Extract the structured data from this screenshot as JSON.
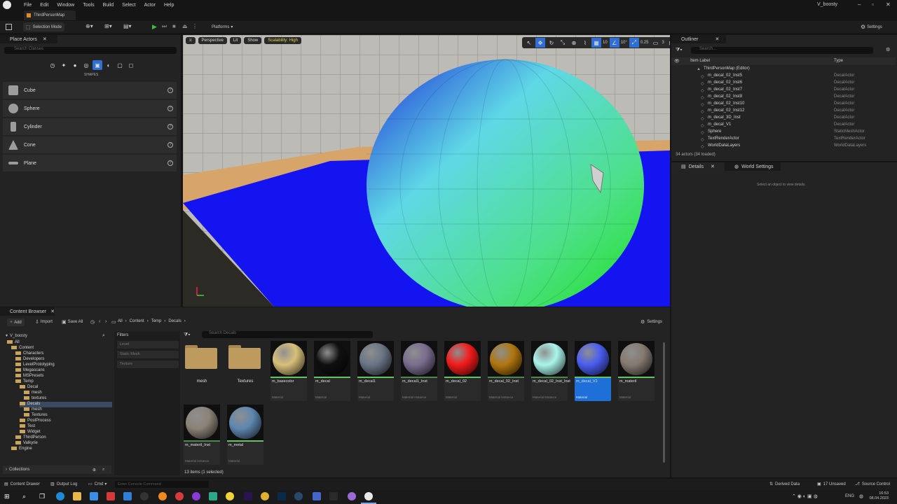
{
  "menu": [
    "File",
    "Edit",
    "Window",
    "Tools",
    "Build",
    "Select",
    "Actor",
    "Help"
  ],
  "project_name": "V_boosty",
  "level_tab": "ThirdPersonMap",
  "toolbar": {
    "selection_mode": "Selection Mode",
    "platforms": "Platforms",
    "settings": "Settings"
  },
  "place_actors": {
    "tab": "Place Actors",
    "search_placeholder": "Search Classes",
    "category": "SHAPES",
    "items": [
      "Cube",
      "Sphere",
      "Cylinder",
      "Cone",
      "Plane"
    ]
  },
  "viewport": {
    "perspective": "Perspective",
    "lit": "Lit",
    "show": "Show",
    "scalability": "Scalability: High",
    "grid": "10",
    "angle": "10°",
    "scale": "0.25",
    "camera": "3"
  },
  "outliner": {
    "tab": "Outliner",
    "search_placeholder": "Search...",
    "col_label": "Item Label",
    "col_type": "Type",
    "rows": [
      {
        "name": "ThirdPersonMap (Editor)",
        "type": ""
      },
      {
        "name": "m_decal_02_Inst5",
        "type": "DecalActor"
      },
      {
        "name": "m_decal_02_Inst6",
        "type": "DecalActor"
      },
      {
        "name": "m_decal_02_Inst7",
        "type": "DecalActor"
      },
      {
        "name": "m_decal_02_Inst8",
        "type": "DecalActor"
      },
      {
        "name": "m_decal_02_Inst10",
        "type": "DecalActor"
      },
      {
        "name": "m_decal_02_Inst12",
        "type": "DecalActor"
      },
      {
        "name": "m_decal_3D_Inst",
        "type": "DecalActor"
      },
      {
        "name": "m_decal_V1",
        "type": "DecalActor"
      },
      {
        "name": "Sphere",
        "type": "StaticMeshActor"
      },
      {
        "name": "TextRenderActor",
        "type": "TextRenderActor"
      },
      {
        "name": "WorldDataLayers",
        "type": "WorldDataLayers"
      }
    ],
    "count": "34 actors (34 loaded)"
  },
  "details": {
    "tab": "Details",
    "world_settings": "World Settings",
    "empty": "Select an object to view details."
  },
  "content_browser": {
    "tab": "Content Browser",
    "add": "Add",
    "import": "Import",
    "save_all": "Save All",
    "settings": "Settings",
    "breadcrumb": [
      "All",
      "Content",
      "Temp",
      "Decals"
    ],
    "search_placeholder": "Search Decals",
    "filters_title": "Filters",
    "filters": [
      "Level",
      "Static Mesh",
      "Texture"
    ],
    "root": "V_boosty",
    "tree": [
      {
        "label": "All",
        "depth": 0
      },
      {
        "label": "Content",
        "depth": 1
      },
      {
        "label": "Characters",
        "depth": 2
      },
      {
        "label": "Developers",
        "depth": 2
      },
      {
        "label": "LevelPrototyping",
        "depth": 2
      },
      {
        "label": "Megascans",
        "depth": 2
      },
      {
        "label": "MSPresets",
        "depth": 2
      },
      {
        "label": "Temp",
        "depth": 2
      },
      {
        "label": "Decal",
        "depth": 3
      },
      {
        "label": "mesh",
        "depth": 4
      },
      {
        "label": "textures",
        "depth": 4
      },
      {
        "label": "Decals",
        "depth": 3
      },
      {
        "label": "mesh",
        "depth": 4
      },
      {
        "label": "Textures",
        "depth": 4
      },
      {
        "label": "PostProcess",
        "depth": 3
      },
      {
        "label": "Test",
        "depth": 3
      },
      {
        "label": "Widget",
        "depth": 3
      },
      {
        "label": "ThirdPerson",
        "depth": 2
      },
      {
        "label": "Valkyrie",
        "depth": 2
      },
      {
        "label": "Engine",
        "depth": 1
      }
    ],
    "collections": "Collections",
    "assets": [
      {
        "name": "mesh",
        "kind": "",
        "folder": true
      },
      {
        "name": "Textures",
        "kind": "",
        "folder": true
      },
      {
        "name": "m_basecolor",
        "kind": "Material",
        "color": "#d8c07a"
      },
      {
        "name": "m_decal",
        "kind": "Material",
        "color": "#101010"
      },
      {
        "name": "m_decal1",
        "kind": "Material",
        "color": "#6a7585"
      },
      {
        "name": "m_decal1_Inst",
        "kind": "Material Instance",
        "color": "#7a6d8f"
      },
      {
        "name": "m_decal_02",
        "kind": "Material",
        "color": "#f21b1b"
      },
      {
        "name": "m_decal_02_Inst",
        "kind": "Material Instance",
        "color": "#b0770f"
      },
      {
        "name": "m_decal_02_Inst_Inst",
        "kind": "Material Instance",
        "color": "#aaf5ec"
      },
      {
        "name": "m_decal_V1",
        "kind": "Material",
        "color": "#4a5ef0"
      },
      {
        "name": "m_materil",
        "kind": "Material",
        "color": "#857a70"
      },
      {
        "name": "m_materil_Inst",
        "kind": "Material Instance",
        "color": "#8c8378"
      },
      {
        "name": "m_metal",
        "kind": "Material",
        "color": "#5f87b0"
      }
    ],
    "status": "13 items (1 selected)"
  },
  "statusbar": {
    "content_drawer": "Content Drawer",
    "output_log": "Output Log",
    "cmd": "Cmd",
    "console_placeholder": "Enter Console Command",
    "derived_data": "Derived Data",
    "unsaved": "17 Unsaved",
    "source_control": "Source Control"
  },
  "taskbar": {
    "lang": "ENG",
    "time": "16:53",
    "date": "08.04.2023"
  }
}
